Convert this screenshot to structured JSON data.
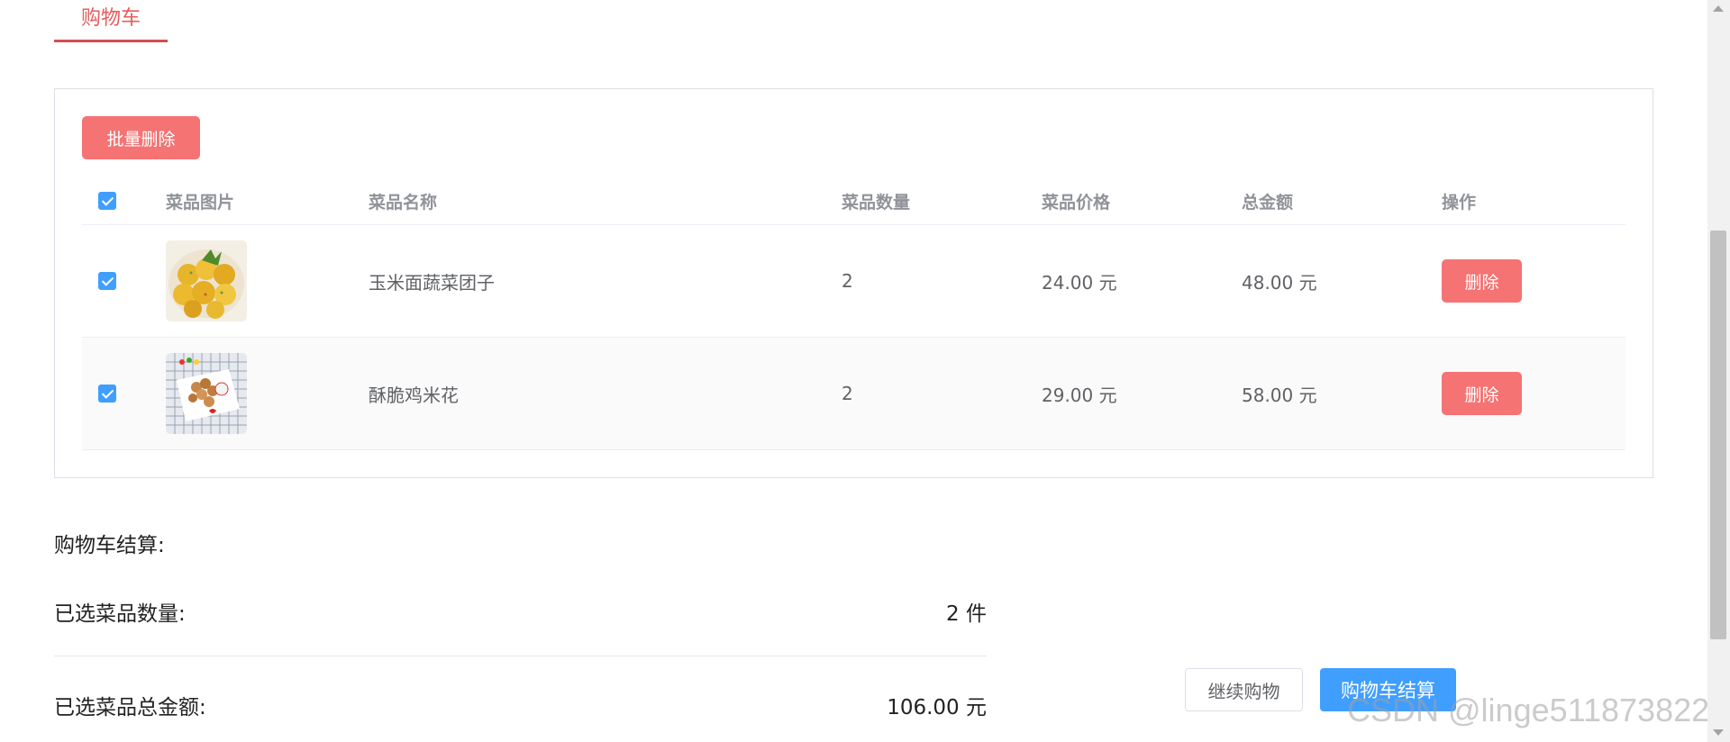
{
  "tabs": {
    "active": "购物车"
  },
  "cart": {
    "batch_delete_label": "批量删除",
    "columns": [
      "菜品图片",
      "菜品名称",
      "菜品数量",
      "菜品价格",
      "总金额",
      "操作"
    ],
    "items": [
      {
        "image": "corn-vegetable-balls-photo",
        "name": "玉米面蔬菜团子",
        "quantity": "2",
        "price": "24.00 元",
        "total": "48.00 元",
        "delete_label": "删除",
        "checked": true
      },
      {
        "image": "crispy-popcorn-chicken-photo",
        "name": "酥脆鸡米花",
        "quantity": "2",
        "price": "29.00 元",
        "total": "58.00 元",
        "delete_label": "删除",
        "checked": true
      }
    ]
  },
  "settlement": {
    "title": "购物车结算:",
    "selected_count_label": "已选菜品数量:",
    "selected_count_value": "2 件",
    "selected_total_label": "已选菜品总金额:",
    "selected_total_value": "106.00 元",
    "continue_label": "继续购物",
    "checkout_label": "购物车结算"
  },
  "watermark": "CSDN @linge511873822",
  "colors": {
    "danger": "#f57373",
    "primary": "#409eff",
    "tab_active": "#e75c5c"
  }
}
